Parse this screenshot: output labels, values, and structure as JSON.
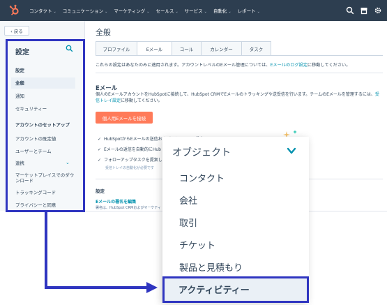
{
  "topnav": {
    "items": [
      {
        "label": "コンタクト"
      },
      {
        "label": "コミュニケーション"
      },
      {
        "label": "マーケティング"
      },
      {
        "label": "セールス"
      },
      {
        "label": "サービス"
      },
      {
        "label": "自動化"
      },
      {
        "label": "レポート"
      }
    ],
    "chevron": "⌄",
    "icons": [
      "hubspot-logo-icon",
      "search-icon",
      "marketplace-icon",
      "settings-icon"
    ],
    "bg_color": "#2d3e50"
  },
  "sidebar": {
    "back_label": "‹ 戻る",
    "title": "設定",
    "sections": {
      "general_heading": "設定",
      "general_item": "全般",
      "notifications": "通知",
      "security": "セキュリティー",
      "account_heading": "アカウントのセットアップ",
      "account_defaults": "アカウントの既定値",
      "users_teams": "ユーザーとチーム",
      "integrations": "連携",
      "marketplace_downloads": "マーケットプレイスでのダウンロード",
      "tracking_code": "トラッキングコード",
      "privacy_consent": "プライバシーと同意"
    }
  },
  "main": {
    "title": "全般",
    "tabs": [
      {
        "label": "プロファイル"
      },
      {
        "label": "Eメール"
      },
      {
        "label": "コール"
      },
      {
        "label": "カレンダー"
      },
      {
        "label": "タスク"
      }
    ],
    "active_tab": "Eメール",
    "note_prefix": "これらの設定はあなたのみに適用されます。アカウントレベルのEメール管理については、",
    "note_link": "Eメールのログ設定",
    "note_suffix": "に移動してください。",
    "email_title": "Eメール",
    "email_desc_line1": "個人のEメールアカウントをHubSpotに接続して、HubSpot CRMでEメールのトラッキングや送受信を行います。チームのEメールを管理するには、",
    "email_desc_link": "受信トレイ設定",
    "email_desc_suffix": "に移動してください。",
    "connect_button": "個人用Eメールを接続",
    "checklist": [
      "HubSpotからEメールの送信およびスケジュール設定",
      "Eメールの返信を自動的にHub",
      "フォローアップタスクを提案し"
    ],
    "checklist_sub": "受信トレイの自動化が必要です",
    "settings_label": "設定",
    "signature_link": "Eメールの署名を編集",
    "signature_sub": "署名は、HubSpot CRMおよびマーケティ"
  },
  "dropdown": {
    "heading": "オブジェクト",
    "items": [
      {
        "label": "コンタクト"
      },
      {
        "label": "会社"
      },
      {
        "label": "取引"
      },
      {
        "label": "チケット"
      },
      {
        "label": "製品と見積もり"
      }
    ],
    "highlighted_item": "アクティビティー"
  },
  "colors": {
    "accent_orange": "#ff7a59",
    "link_teal": "#0091ae",
    "annotation_blue": "#2f35c0",
    "text_dark": "#33475b"
  }
}
